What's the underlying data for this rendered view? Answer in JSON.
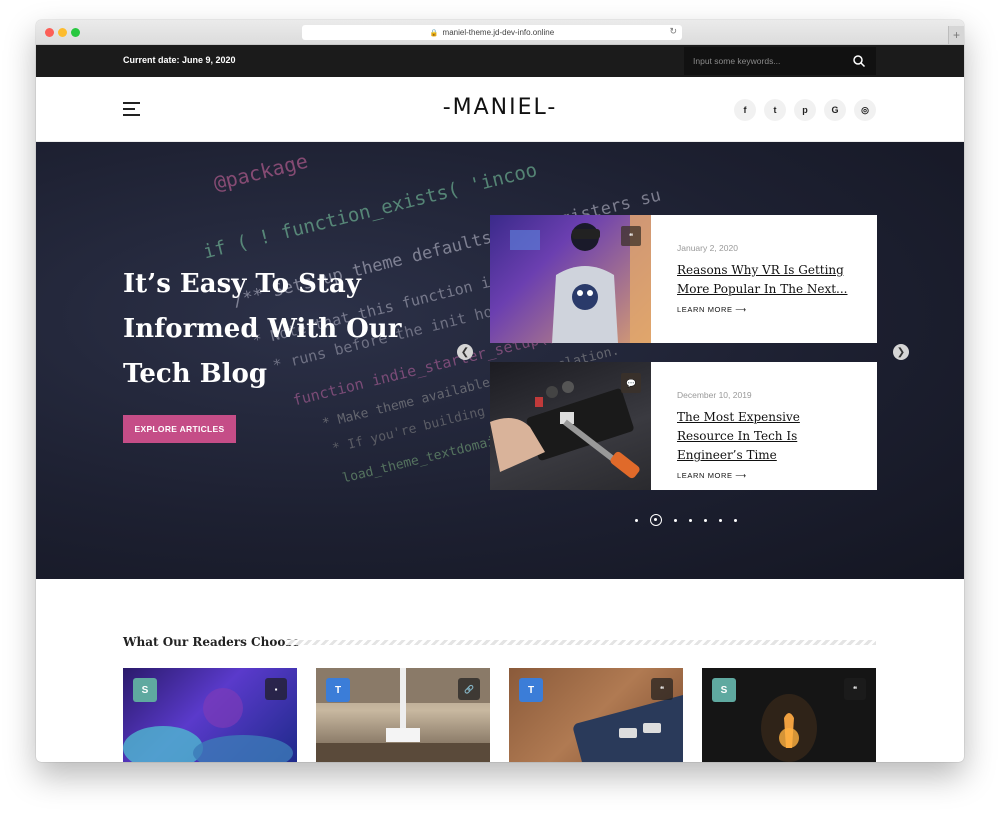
{
  "browser": {
    "url": "maniel-theme.jd-dev-info.online",
    "newtab_glyph": "+"
  },
  "topbar": {
    "current_date": "Current date: June 9, 2020",
    "search_placeholder": "Input some keywords..."
  },
  "header": {
    "logo": "-MANIEL-",
    "socials": [
      {
        "icon": "facebook-icon",
        "glyph": "f"
      },
      {
        "icon": "twitter-icon",
        "glyph": "t"
      },
      {
        "icon": "pinterest-icon",
        "glyph": "p"
      },
      {
        "icon": "google-icon",
        "glyph": "G"
      },
      {
        "icon": "instagram-icon",
        "glyph": "◎"
      }
    ]
  },
  "hero": {
    "title": "It’s Easy To Stay Informed With Our Tech Blog",
    "button": "EXPLORE ARTICLES",
    "code_lines": [
      "@package",
      "if ( ! function_exists( 'incoo",
      "/** Sets up theme defaults and registers su",
      " * Note that this function is hooked into the after_se",
      " * runs before the init hook. The init hook is too late for s",
      "function indie_starter_setup() {",
      "  * Make theme available for translation.",
      "  * If you're building a theme based on",
      "load_theme_textdomain("
    ],
    "slides": [
      {
        "date": "January 2, 2020",
        "title": "Reasons Why VR Is Getting More Popular In The Next...",
        "link": "LEARN MORE",
        "format_icon": "quote-icon"
      },
      {
        "date": "December 10, 2019",
        "title": "The Most Expensive Resource In Tech Is Engineer’s Time",
        "link": "LEARN MORE",
        "format_icon": "chat-icon"
      }
    ],
    "slider_dots": 7,
    "active_dot": 2
  },
  "section": {
    "title": "What Our Readers Choose",
    "posts": [
      {
        "category": "S",
        "category_color": "#5fa9a0",
        "format_icon": "chat-icon"
      },
      {
        "category": "T",
        "category_color": "#3b7dd8",
        "format_icon": "link-icon"
      },
      {
        "category": "T",
        "category_color": "#3b7dd8",
        "format_icon": "quote-icon"
      },
      {
        "category": "S",
        "category_color": "#5fa9a0",
        "format_icon": "quote-icon"
      }
    ]
  },
  "colors": {
    "accent": "#c54d87",
    "topbar": "#1b1b1b",
    "hero_bg": "#1d2031"
  }
}
